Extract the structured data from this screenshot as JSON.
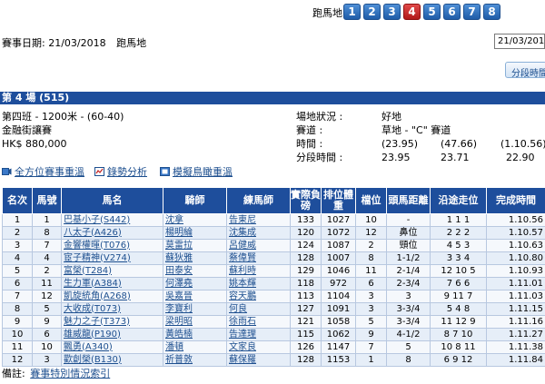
{
  "race_nav": {
    "label": "跑馬地:",
    "tabs": [
      "1",
      "2",
      "3",
      "4",
      "5",
      "6",
      "7",
      "8"
    ],
    "active": "4"
  },
  "meeting": {
    "date_label": "賽事日期:",
    "date": "21/03/2018",
    "venue": "跑馬地",
    "date_select": "21/03/2018"
  },
  "split_button": "分段時間",
  "race": {
    "header": "第 4 場 (515)",
    "class_distance": "第四班 - 1200米 - (60-40)",
    "name": "金融街讓賽",
    "prize": "HK$ 880,000",
    "going_label": "場地狀況 :",
    "going": "好地",
    "course_label": "賽道 :",
    "course": "草地 - \"C\" 賽道",
    "time_label": "時間 :",
    "times": [
      "(23.95)",
      "(47.66)",
      "(1.10.56)"
    ],
    "sectional_label": "分段時間 :",
    "sectionals": [
      "23.95",
      "23.71",
      "22.90"
    ]
  },
  "links": {
    "replay_all": "全方位賽事重溫",
    "pace": "錄勢分析",
    "stalls": "模擬鳥瞰重溫"
  },
  "table": {
    "headers": [
      "名次",
      "馬號",
      "馬名",
      "騎師",
      "練馬師",
      "實際負磅",
      "排位體重",
      "檔位",
      "頭馬距離",
      "沿途走位",
      "完成時間"
    ],
    "rows": [
      [
        "1",
        "1",
        "巴基小子(S442)",
        "沈拿",
        "告東尼",
        "133",
        "1027",
        "10",
        "-",
        "1 1 1",
        "1.10.56"
      ],
      [
        "2",
        "8",
        "八太子(A426)",
        "楊明綸",
        "沈集成",
        "120",
        "1072",
        "12",
        "鼻位",
        "2 2 2",
        "1.10.57"
      ],
      [
        "3",
        "7",
        "金響權暉(T076)",
        "莫雷拉",
        "呂健威",
        "124",
        "1087",
        "2",
        "頸位",
        "4 5 3",
        "1.10.63"
      ],
      [
        "4",
        "4",
        "宦子精神(V274)",
        "蘇狄雅",
        "蔡偉賢",
        "128",
        "1007",
        "8",
        "1-1/2",
        "3 3 4",
        "1.10.80"
      ],
      [
        "5",
        "2",
        "富榮(T284)",
        "田泰安",
        "蘇利時",
        "129",
        "1046",
        "11",
        "2-1/4",
        "12 10 5",
        "1.10.93"
      ],
      [
        "6",
        "11",
        "生力軍(A384)",
        "何澤堯",
        "姚本輝",
        "118",
        "972",
        "6",
        "2-3/4",
        "7 6 6",
        "1.11.01"
      ],
      [
        "7",
        "12",
        "凱旋統角(A268)",
        "吳嘉晉",
        "容天鵬",
        "113",
        "1104",
        "3",
        "3",
        "9 11 7",
        "1.11.03"
      ],
      [
        "8",
        "5",
        "大收成(T073)",
        "李寶利",
        "何良",
        "127",
        "1091",
        "3",
        "3-3/4",
        "5 4 8",
        "1.11.15"
      ],
      [
        "9",
        "9",
        "魅力之子(T373)",
        "梁明昭",
        "徐雨石",
        "121",
        "1058",
        "5",
        "3-3/4",
        "11 12 9",
        "1.11.16"
      ],
      [
        "10",
        "6",
        "雄威龍(P190)",
        "黃皓楠",
        "告達理",
        "115",
        "1062",
        "9",
        "4-1/2",
        "8 7 10",
        "1.11.27"
      ],
      [
        "11",
        "10",
        "飄勇(A340)",
        "潘頓",
        "文家良",
        "126",
        "1147",
        "7",
        "5",
        "10 8 11",
        "1.11.38"
      ],
      [
        "12",
        "3",
        "歡創榮(B130)",
        "祈普敦",
        "蘇保羅",
        "128",
        "1153",
        "1",
        "8",
        "6 9 12",
        "1.11.84"
      ]
    ]
  },
  "remark": {
    "label": "備註:",
    "link": "賽事特別情況索引"
  }
}
